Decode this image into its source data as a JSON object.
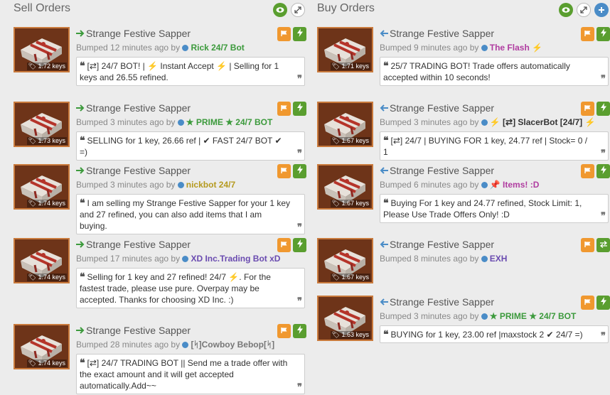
{
  "sell": {
    "heading": "Sell Orders",
    "listings": [
      {
        "name": "Strange Festive Sapper",
        "bumped": "Bumped 12 minutes ago by",
        "user": "Rick 24/7 Bot",
        "user_color": "#3c9a3c",
        "user_prefix": "",
        "price": "1.72 keys",
        "desc": "[⇄] 24/7 BOT! | ⚡ Instant Accept ⚡ | Selling for 1 keys and 26.55 refined."
      },
      {
        "name": "Strange Festive Sapper",
        "bumped": "Bumped 3 minutes ago by",
        "user": "PRIME ★ 24/7 BOT",
        "user_color": "#3c9a3c",
        "user_prefix": "★",
        "price": "1.73 keys",
        "desc": "SELLING for 1 key, 26.66 ref | ✔ FAST 24/7 BOT ✔ =)"
      },
      {
        "name": "Strange Festive Sapper",
        "bumped": "Bumped 3 minutes ago by",
        "user": "nickbot 24/7",
        "user_color": "#b59a1f",
        "user_prefix": "",
        "price": "1.74 keys",
        "desc": "I am selling my Strange Festive Sapper for your 1 key and 27 refined, you can also add items that I am buying."
      },
      {
        "name": "Strange Festive Sapper",
        "bumped": "Bumped 17 minutes ago by",
        "user": "XD Inc.Trading Bot",
        "user_color": "#6a4bb0",
        "user_prefix": "",
        "user_suffix": "xD",
        "price": "1.74 keys",
        "desc": "Selling for 1 key and 27 refined! 24/7 ⚡. For the fastest trade, please use pure. Overpay may be accepted. Thanks for choosing XD Inc. :)"
      },
      {
        "name": "Strange Festive Sapper",
        "bumped": "Bumped 28 minutes ago by",
        "user": "[ᛋ]Cowboy Bebop[ᛋ]",
        "user_color": "#777777",
        "user_prefix": "",
        "price": "1.74 keys",
        "desc": "[⇄] 24/7 TRADING BOT || Send me a trade offer with the exact amount and it will get accepted automatically.Add~~"
      }
    ]
  },
  "buy": {
    "heading": "Buy Orders",
    "listings": [
      {
        "name": "Strange Festive Sapper",
        "bumped": "Bumped 9 minutes ago by",
        "user": "The Flash",
        "user_color": "#b03ca0",
        "user_prefix": "",
        "user_suffix": "⚡",
        "price": "1.71 keys",
        "desc": "25/7 TRADING BOT! Trade offers automatically accepted within 10 seconds!"
      },
      {
        "name": "Strange Festive Sapper",
        "bumped": "Bumped 3 minutes ago by",
        "user": "[⇄] SlacerBot [24/7]",
        "user_color": "#333333",
        "user_prefix": "⚡",
        "user_suffix": "⚡",
        "price": "1.67 keys",
        "desc": "[⇄] 24/7 | BUYING FOR 1 key, 24.77 ref | Stock= 0 / 1"
      },
      {
        "name": "Strange Festive Sapper",
        "bumped": "Bumped 6 minutes ago by",
        "user": "Items! :D",
        "user_color": "#b03ca0",
        "user_prefix": "📌",
        "price": "1.67 keys",
        "desc": "Buying For 1 key and 24.77 refined, Stock Limit: 1, Please Use Trade Offers Only! :D"
      },
      {
        "name": "Strange Festive Sapper",
        "bumped": "Bumped 8 minutes ago by",
        "user": "EXH",
        "user_color": "#6a4bb0",
        "user_prefix": "",
        "price": "1.67 keys",
        "desc": ""
      },
      {
        "name": "Strange Festive Sapper",
        "bumped": "Bumped 3 minutes ago by",
        "user": "PRIME ★ 24/7 BOT",
        "user_color": "#3c9a3c",
        "user_prefix": "★",
        "price": "1.63 keys",
        "desc": "BUYING for 1 key, 23.00 ref |maxstock 2 ✔ 24/7 =)"
      }
    ]
  },
  "icons": {
    "eye": "eye-icon",
    "expand": "expand-icon",
    "plus": "plus-icon",
    "flag": "flag-icon",
    "bolt": "lightning-icon",
    "swap": "swap-icon"
  }
}
